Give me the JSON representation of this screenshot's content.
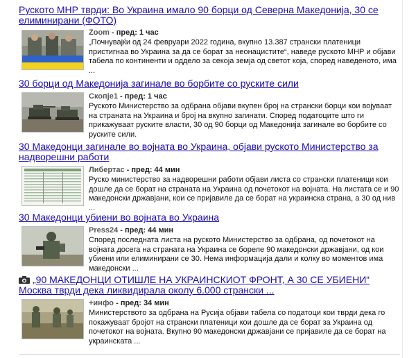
{
  "articles": [
    {
      "title": "Руското МНР тврди: Во Украина имало 90 борци од Северна Македонија, 30 се елиминирани (ФОТО)",
      "source": "Zoom",
      "separator": " - ",
      "time": "пред: 1 час",
      "snippet": "„Почнувајќи од 24 февруари 2022 година, вкупно 13.387 странски платеници пристигнаа во Украина за да се борат за неонацистите“, наведе руското МНР и објави табела по континенти и оддело за секоја земја од светот која, според наведеното, има ...",
      "thumb_icon": "soldiers-with-flag-photo-icon"
    },
    {
      "title": "30 борци од Македонија загинале во борбите со руските сили",
      "source": "Скопје1",
      "separator": " - ",
      "time": "пред: 1 час",
      "snippet": "Руското Министерство за одбрана објави вкупен број на странски борци кои војуваат на страната на Украина и број на вкупно загинати. Според податоците што ги прикажуваат руските власти, 30 од 90 борци од Македонија загинале во борбите со руските сили.",
      "thumb_icon": "tanks-photo-icon"
    },
    {
      "title": "30 Македонци загинале во војната во Украина, објави руското Министерство за надворешни работи",
      "source": "Либертас",
      "separator": " - ",
      "time": "пред: 44 мин",
      "snippet": "Руско министерство за надворешни работи објави листа со странски платеници кои дошле да се борат на страната на Украина од почетокот на војната. На листата се и 90 македонски државјани, кои се пријавиле да се борат на украинска страна, а 30 од нив ...",
      "thumb_icon": "data-table-photo-icon"
    },
    {
      "title": "30 Македонци убиени во војната во Украина",
      "source": "Press24",
      "separator": " - ",
      "time": "пред: 44 мин",
      "snippet": "Според последната листа на руското Министерство за одбрана, од почетокот на војната досега на страната на Украина се бореле 90 македонски државјани, од кои убиени или елиминирани се 30. Нема информација дали и колку во моментов има македонски ...",
      "thumb_icon": "soldier-photo-icon"
    },
    {
      "title": "„90 МАКЕДОНЦИ ОТИШЛЕ НА УКРАИНСКИОТ ФРОНТ, А 30 СЕ УБИЕНИ“ Москва тврди дека ликвидирала околу 6.000 странски ...",
      "source": "+инфо",
      "separator": " - ",
      "time": "пред: 34 мин",
      "snippet": "Министерството за одбрана на Русија објави табела со податоци кои тврди дека го покажуваат бројот на странски платеници кои дошле да се борат за Украина од почетокот на војната. Вкупно 90 македонски државјани се пријавиле да се борат на украинската ...",
      "thumb_icon": "soldiers-field-photo-icon",
      "title_icon": "camera-icon"
    }
  ]
}
